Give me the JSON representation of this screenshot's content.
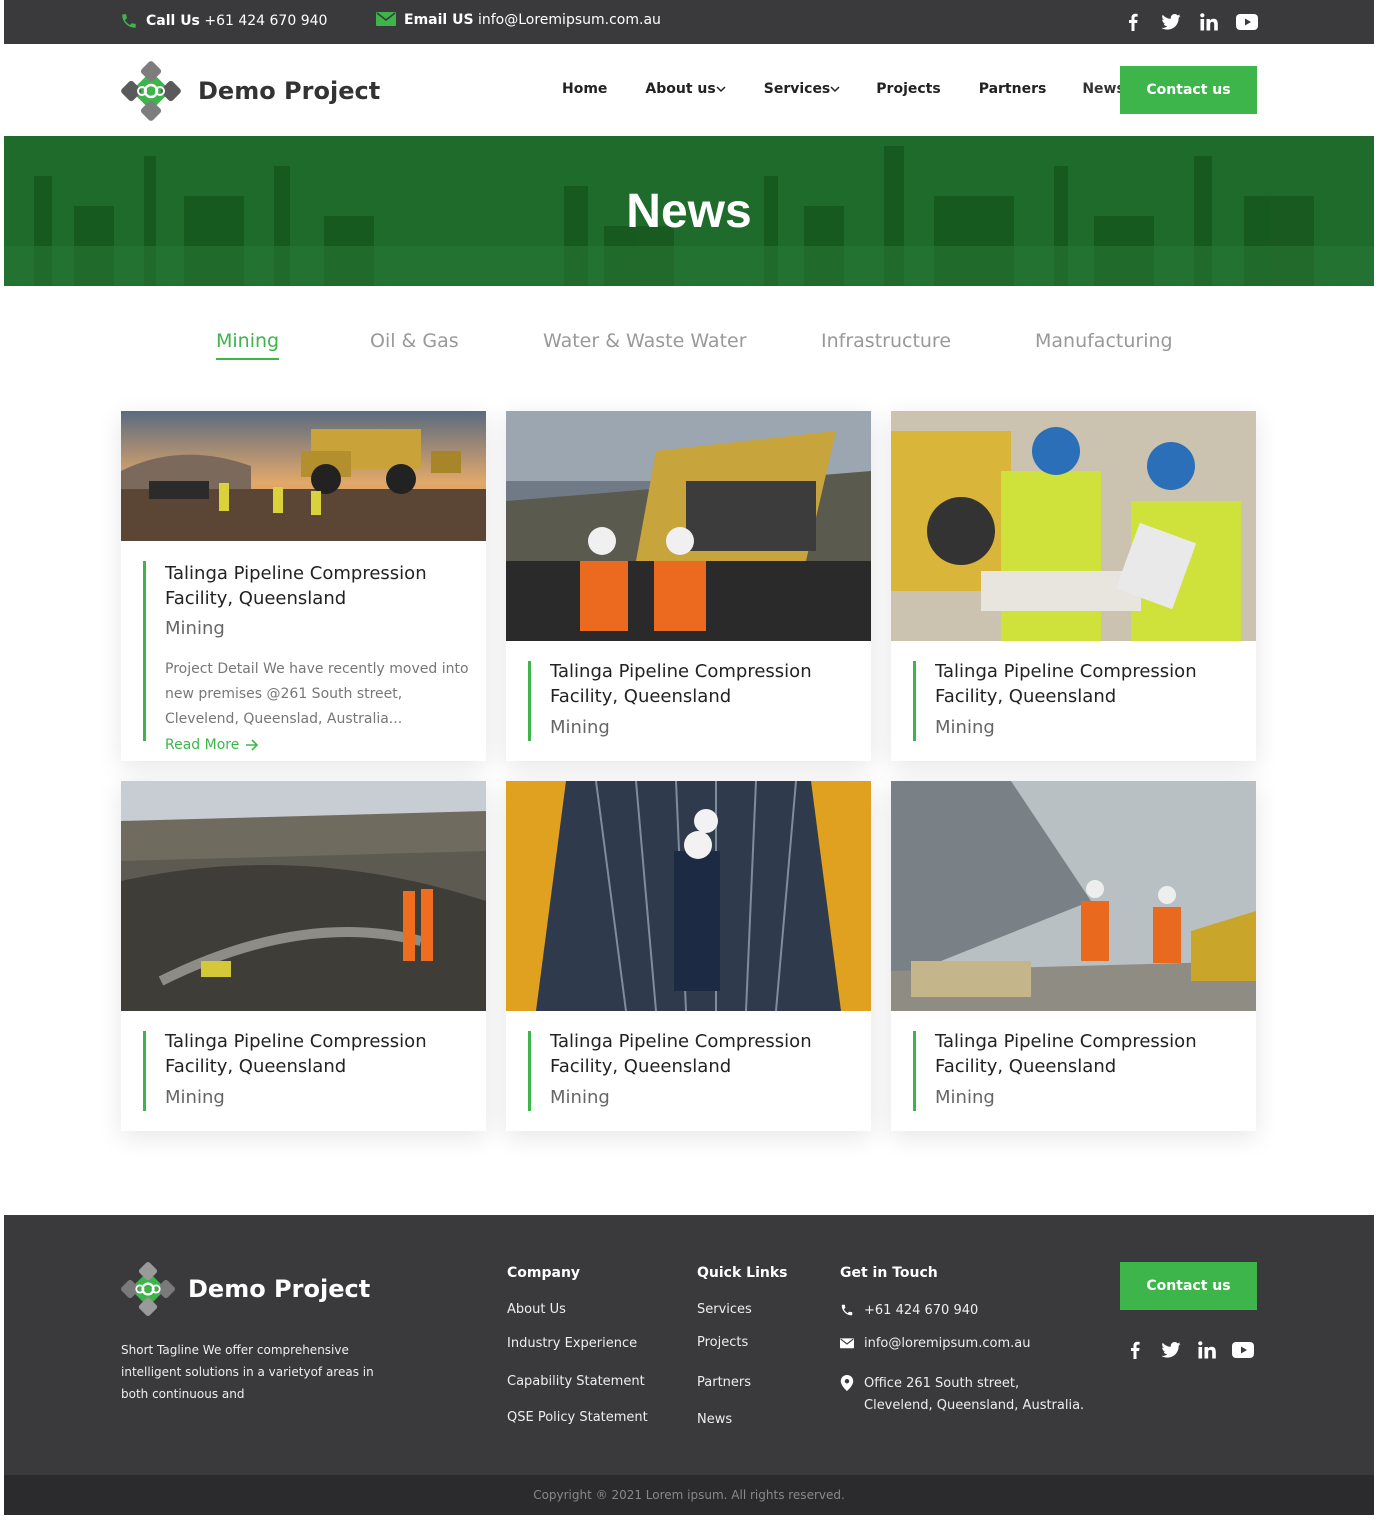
{
  "topbar": {
    "call_label": "Call Us",
    "call_value": "+61 424 670 940",
    "email_label": "Email US",
    "email_value": "info@Loremipsum.com.au",
    "social": [
      "facebook-icon",
      "twitter-icon",
      "linkedin-icon",
      "youtube-icon"
    ]
  },
  "header": {
    "logo_text": "Demo Project",
    "nav": {
      "home": "Home",
      "about": "About us",
      "services": "Services",
      "projects": "Projects",
      "partners": "Partners",
      "news": "News"
    },
    "cta": "Contact us"
  },
  "hero": {
    "title": "News"
  },
  "tabs": {
    "mining": "Mining",
    "oil_gas": "Oil & Gas",
    "water": "Water & Waste Water",
    "infrastructure": "Infrastructure",
    "manufacturing": "Manufacturing",
    "active": "Mining"
  },
  "cards": [
    {
      "title": "Talinga Pipeline Compression Facility, Queensland",
      "category": "Mining",
      "description": "Project Detail We have recently moved into new premises @261 South street, Clevelend, Queenslad, Australia...",
      "read_more": "Read More"
    },
    {
      "title": "Talinga Pipeline Compression Facility, Queensland",
      "category": "Mining"
    },
    {
      "title": "Talinga Pipeline Compression Facility, Queensland",
      "category": "Mining"
    },
    {
      "title": "Talinga Pipeline Compression Facility, Queensland",
      "category": "Mining"
    },
    {
      "title": "Talinga Pipeline Compression Facility, Queensland",
      "category": "Mining"
    },
    {
      "title": "Talinga Pipeline Compression Facility, Queensland",
      "category": "Mining"
    }
  ],
  "footer": {
    "logo_text": "Demo Project",
    "tagline": "Short Tagline We offer comprehensive intelligent solutions in a varietyof areas in both continuous and",
    "company": {
      "heading": "Company",
      "links": [
        "About Us",
        "Industry Experience",
        "Capability Statement",
        "QSE Policy Statement"
      ]
    },
    "quick_links": {
      "heading": "Quick Links",
      "links": [
        "Services",
        "Projects",
        "Partners",
        "News"
      ]
    },
    "get_in_touch": {
      "heading": "Get in Touch",
      "phone": "+61 424 670 940",
      "email": "info@loremipsum.com.au",
      "address_line1": "Office 261 South street,",
      "address_line2": "Clevelend, Queensland, Australia."
    },
    "cta": "Contact us",
    "copyright": "Copyright ® 2021 Lorem ipsum. All rights reserved."
  },
  "colors": {
    "accent": "#3db54a",
    "dark": "#3a3a3c",
    "hero": "#1f6b2c"
  }
}
